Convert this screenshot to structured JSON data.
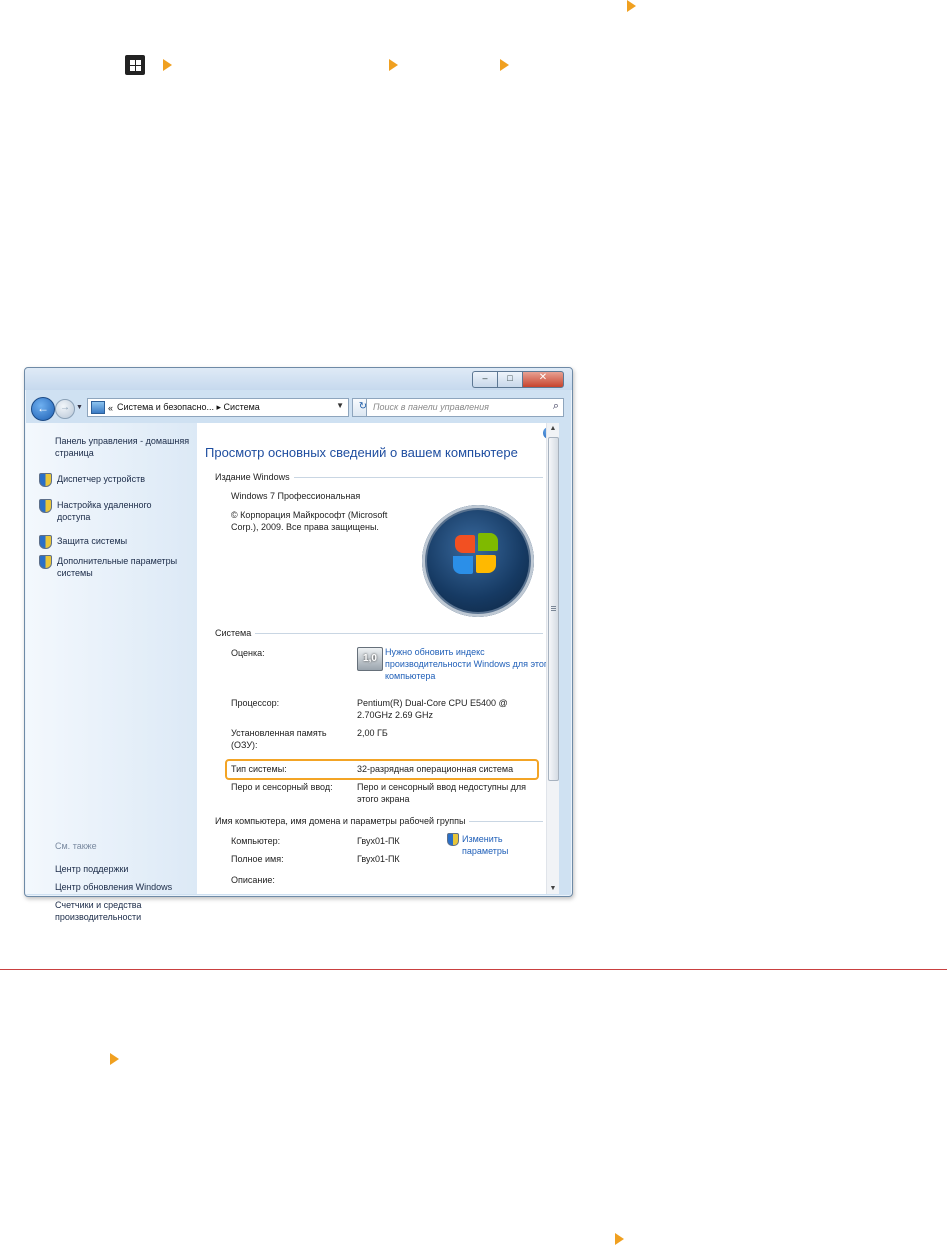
{
  "window": {
    "caption_buttons": {
      "minimize": "‒",
      "maximize": "□",
      "close": "✕"
    },
    "breadcrumb": {
      "prefix": "«",
      "path": "Система и безопасно... ▸ Система"
    },
    "search_placeholder": "Поиск в панели управления",
    "sidebar": {
      "home": "Панель управления - домашняя страница",
      "items": [
        "Диспетчер устройств",
        "Настройка удаленного доступа",
        "Защита системы",
        "Дополнительные параметры системы"
      ],
      "see_also": "См. также",
      "bottom_links": [
        "Центр поддержки",
        "Центр обновления Windows",
        "Счетчики и средства производительности"
      ]
    },
    "content": {
      "title": "Просмотр основных сведений о вашем компьютере",
      "edition_header": "Издание Windows",
      "edition_name": "Windows 7 Профессиональная",
      "copyright": "© Корпорация Майкрософт (Microsoft Corp.), 2009. Все права защищены.",
      "system_header": "Система",
      "rating_label": "Оценка:",
      "rating_score": "1,0",
      "rating_link": "Нужно обновить индекс производительности Windows для этого компьютера",
      "processor_label": "Процессор:",
      "processor_value": "Pentium(R) Dual-Core CPU    E5400 @ 2.70GHz  2.69 GHz",
      "memory_label": "Установленная память (ОЗУ):",
      "memory_value": "2,00 ГБ",
      "systype_label": "Тип системы:",
      "systype_value": "32-разрядная операционная система",
      "pen_label": "Перо и сенсорный ввод:",
      "pen_value": "Перо и сенсорный ввод недоступны для этого экрана",
      "name_header": "Имя компьютера, имя домена и параметры рабочей группы",
      "computer_label": "Компьютер:",
      "computer_value": "Гвух01-ПК",
      "fullname_label": "Полное имя:",
      "fullname_value": "Гвух01-ПК",
      "description_label": "Описание:",
      "change_link": "Изменить параметры"
    }
  },
  "colors": {
    "accent_triangle": "#f0a020",
    "highlight": "#f3a425",
    "divider": "#c94040",
    "link": "#1f5fb8"
  }
}
